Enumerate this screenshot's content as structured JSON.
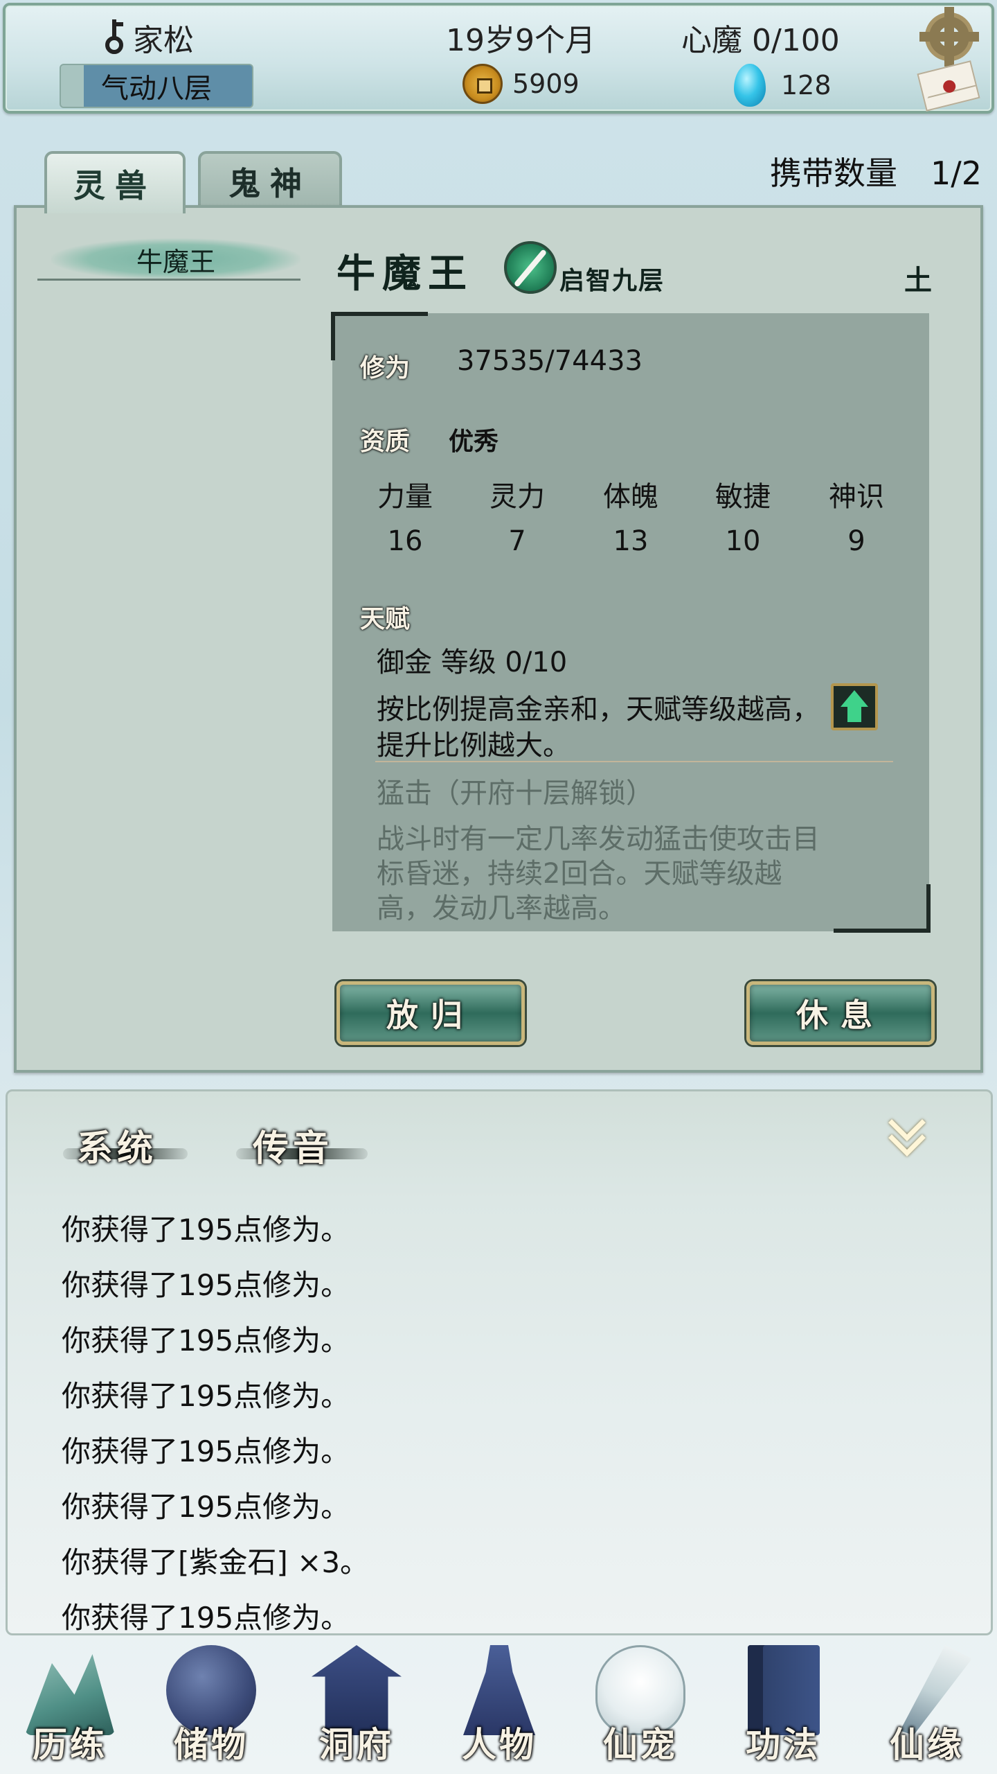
{
  "header": {
    "player_name": "家松",
    "realm": "气动八层",
    "age": "19岁9个月",
    "coins": "5909",
    "inner_demon": "心魔  0/100",
    "gems": "128"
  },
  "tabs": [
    {
      "label": "灵兽",
      "active": true
    },
    {
      "label": "鬼神",
      "active": false
    }
  ],
  "carry": {
    "label": "携带数量",
    "value": "1/2"
  },
  "pet": {
    "list_name": "牛魔王",
    "name": "牛魔王",
    "realm": "启智九层",
    "element": "土",
    "cultivation_label": "修为",
    "cultivation_value": "37535/74433",
    "aptitude_label": "资质",
    "aptitude_value": "优秀",
    "stats": [
      {
        "name": "力量",
        "value": "16"
      },
      {
        "name": "灵力",
        "value": "7"
      },
      {
        "name": "体魄",
        "value": "13"
      },
      {
        "name": "敏捷",
        "value": "10"
      },
      {
        "name": "神识",
        "value": "9"
      }
    ],
    "talent_label": "天赋",
    "talent_1": {
      "title": "御金   等级  0/10",
      "desc": "按比例提高金亲和，天赋等级越高，提升比例越大。"
    },
    "talent_2": {
      "title": "猛击（开府十层解锁）",
      "desc": "战斗时有一定几率发动猛击使攻击目标昏迷，持续2回合。天赋等级越高，发动几率越高。"
    }
  },
  "buttons": {
    "release": "放归",
    "rest": "休息"
  },
  "chat": {
    "tab_system": "系统",
    "tab_message": "传音",
    "lines": [
      "你获得了195点修为。",
      "你获得了195点修为。",
      "你获得了195点修为。",
      "你获得了195点修为。",
      "你获得了195点修为。",
      "你获得了195点修为。",
      "你获得了[紫金石] ×3。",
      "你获得了195点修为。"
    ]
  },
  "nav": [
    "历练",
    "储物",
    "洞府",
    "人物",
    "仙宠",
    "功法",
    "仙缘"
  ]
}
